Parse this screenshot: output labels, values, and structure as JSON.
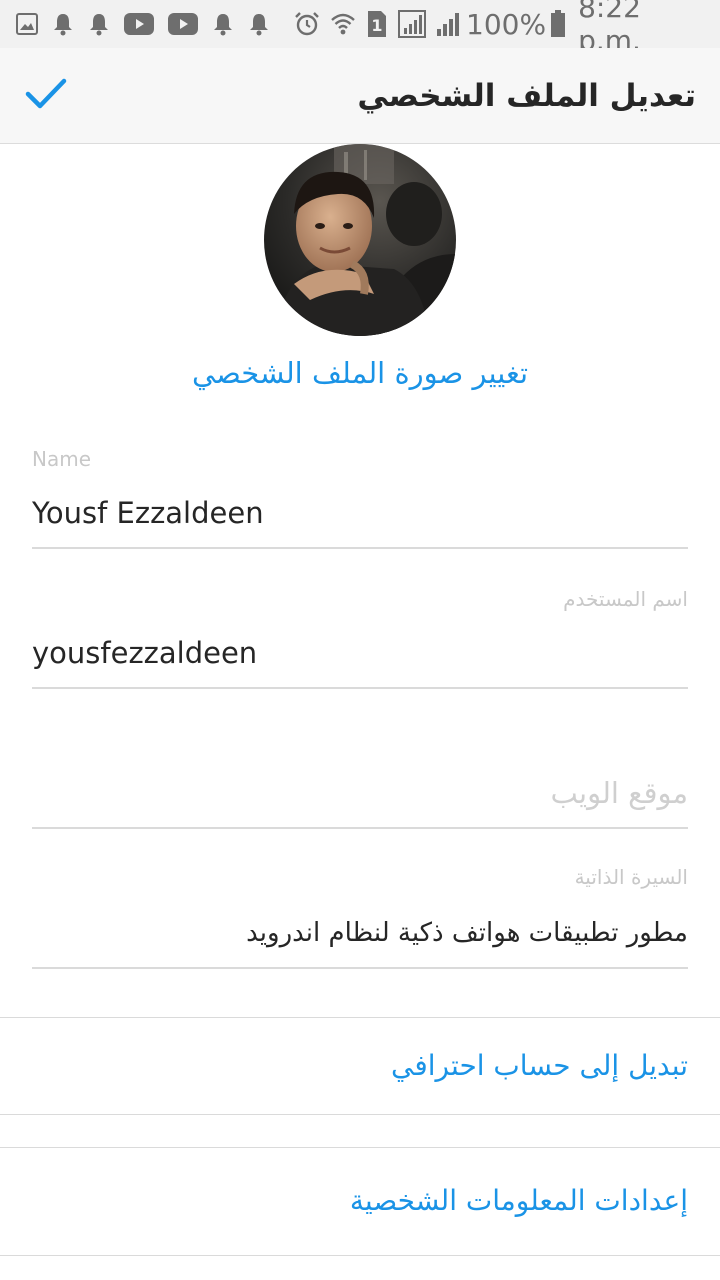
{
  "status_bar": {
    "left_icons": [
      "gallery-icon",
      "bell-icon",
      "bell-icon",
      "youtube-icon",
      "youtube-icon",
      "bell-icon",
      "bell-icon"
    ],
    "right_icons": [
      "alarm-icon",
      "wifi-icon",
      "sim-1-icon",
      "signal-icon",
      "signal-icon",
      "battery-icon"
    ],
    "sim_label": "1",
    "battery_text": "100%",
    "time": "8:22 p.m."
  },
  "header": {
    "title": "تعديل الملف الشخصي",
    "confirm_icon": "check-icon",
    "accent_color": "#1a93e6"
  },
  "profile": {
    "change_photo_label": "تغيير صورة الملف الشخصي"
  },
  "fields": {
    "name": {
      "label": "Name",
      "value": "Yousf Ezzaldeen"
    },
    "username": {
      "label": "اسم المستخدم",
      "value": "yousfezzaldeen"
    },
    "website": {
      "placeholder": "موقع الويب"
    },
    "bio": {
      "label": "السيرة الذاتية",
      "value": "مطور تطبيقات هواتف ذكية لنظام اندرويد"
    }
  },
  "actions": {
    "switch_pro": "تبديل إلى حساب احترافي",
    "personal_info": "إعدادات المعلومات الشخصية"
  }
}
